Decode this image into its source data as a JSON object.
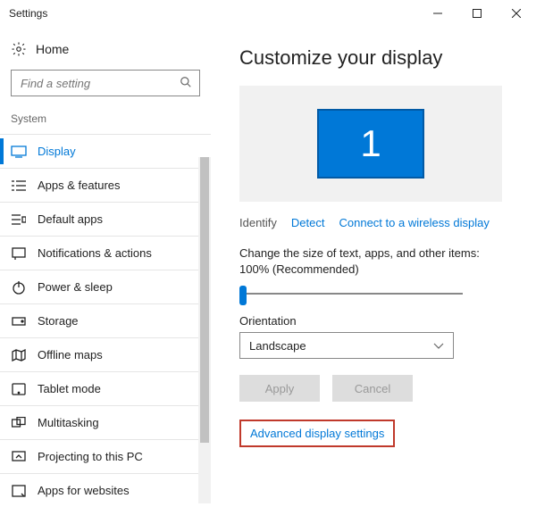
{
  "window": {
    "title": "Settings"
  },
  "sidebar": {
    "home_label": "Home",
    "search_placeholder": "Find a setting",
    "category": "System",
    "items": [
      {
        "label": "Display"
      },
      {
        "label": "Apps & features"
      },
      {
        "label": "Default apps"
      },
      {
        "label": "Notifications & actions"
      },
      {
        "label": "Power & sleep"
      },
      {
        "label": "Storage"
      },
      {
        "label": "Offline maps"
      },
      {
        "label": "Tablet mode"
      },
      {
        "label": "Multitasking"
      },
      {
        "label": "Projecting to this PC"
      },
      {
        "label": "Apps for websites"
      }
    ]
  },
  "main": {
    "title": "Customize your display",
    "monitor_number": "1",
    "identify": "Identify",
    "detect": "Detect",
    "connect_wireless": "Connect to a wireless display",
    "scale_text": "Change the size of text, apps, and other items: 100% (Recommended)",
    "orientation_label": "Orientation",
    "orientation_value": "Landscape",
    "apply": "Apply",
    "cancel": "Cancel",
    "advanced": "Advanced display settings"
  }
}
